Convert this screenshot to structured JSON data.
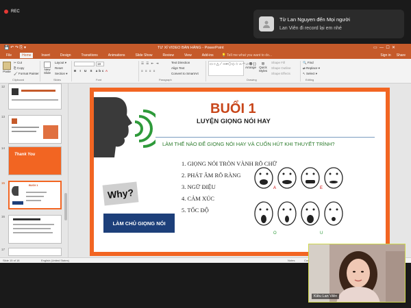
{
  "zoom": {
    "rec_label": "REC",
    "notification": {
      "sender": "Từ Lan  Nguyen đến Mọi người",
      "message": "Lan Viên đi record lại em nhé"
    }
  },
  "ppt": {
    "title": "TƯ XÍ VIDEO BÁN HÀNG - PowerPoint",
    "tabs": [
      "File",
      "Home",
      "Insert",
      "Design",
      "Transitions",
      "Animations",
      "Slide Show",
      "Review",
      "View",
      "Add-ins"
    ],
    "tell_me": "Tell me what you want to do...",
    "right_links": [
      "Sign in",
      "Share"
    ],
    "ribbon": {
      "paste": "Paste",
      "cut": "Cut",
      "copy": "Copy",
      "format_painter": "Format Painter",
      "new_slide": "New Slide",
      "layout": "Layout",
      "reset": "Reset",
      "section": "Section",
      "text_direction": "Text Direction",
      "align_text": "Align Text",
      "smartart": "Convert to SmartArt",
      "arrange": "Arrange",
      "quick_styles": "Quick Styles",
      "shape_fill": "Shape Fill",
      "shape_outline": "Shape Outline",
      "shape_effects": "Shape Effects",
      "find": "Find",
      "replace": "Replace",
      "select": "Select",
      "groups": [
        "Clipboard",
        "Slides",
        "Font",
        "Paragraph",
        "Drawing",
        "Editing"
      ],
      "font_size": "18"
    },
    "thumbs": [
      {
        "num": "12"
      },
      {
        "num": "13"
      },
      {
        "num": "14",
        "text": "Thank You"
      },
      {
        "num": "15"
      },
      {
        "num": "16"
      },
      {
        "num": "17"
      }
    ],
    "status": {
      "slide_info": "Slide 15 of 18",
      "language": "English (United States)",
      "notes": "Notes",
      "comments": "Comments"
    }
  },
  "slide": {
    "title": "BUỔI 1",
    "subtitle": "LUYỆN GIỌNG NÓI HAY",
    "question": "LÀM THẾ NÀO ĐỂ GIỌNG NÓI HAY VÀ CUỐN HÚT KHI THUYẾT TRÌNH?",
    "items": [
      "1.  GIỌNG NÓI TRÒN VÀNH RÕ CHỮ",
      "2.  PHÁT ÂM RÕ RÀNG",
      "3.  NGỮ ĐIỆU",
      "4.  CẢM XÚC",
      "5.  TỐC ĐỘ"
    ],
    "why": "Why?",
    "button": "LÀM CHỦ GIỌNG NÓI"
  },
  "camera": {
    "name": "Kiều Lan Viên"
  },
  "colors": {
    "ppt_accent": "#c55a2a",
    "slide_border": "#f26522",
    "title_red": "#c8461a",
    "button_blue": "#1d3f7a",
    "sound_green": "#2e9a3a"
  }
}
